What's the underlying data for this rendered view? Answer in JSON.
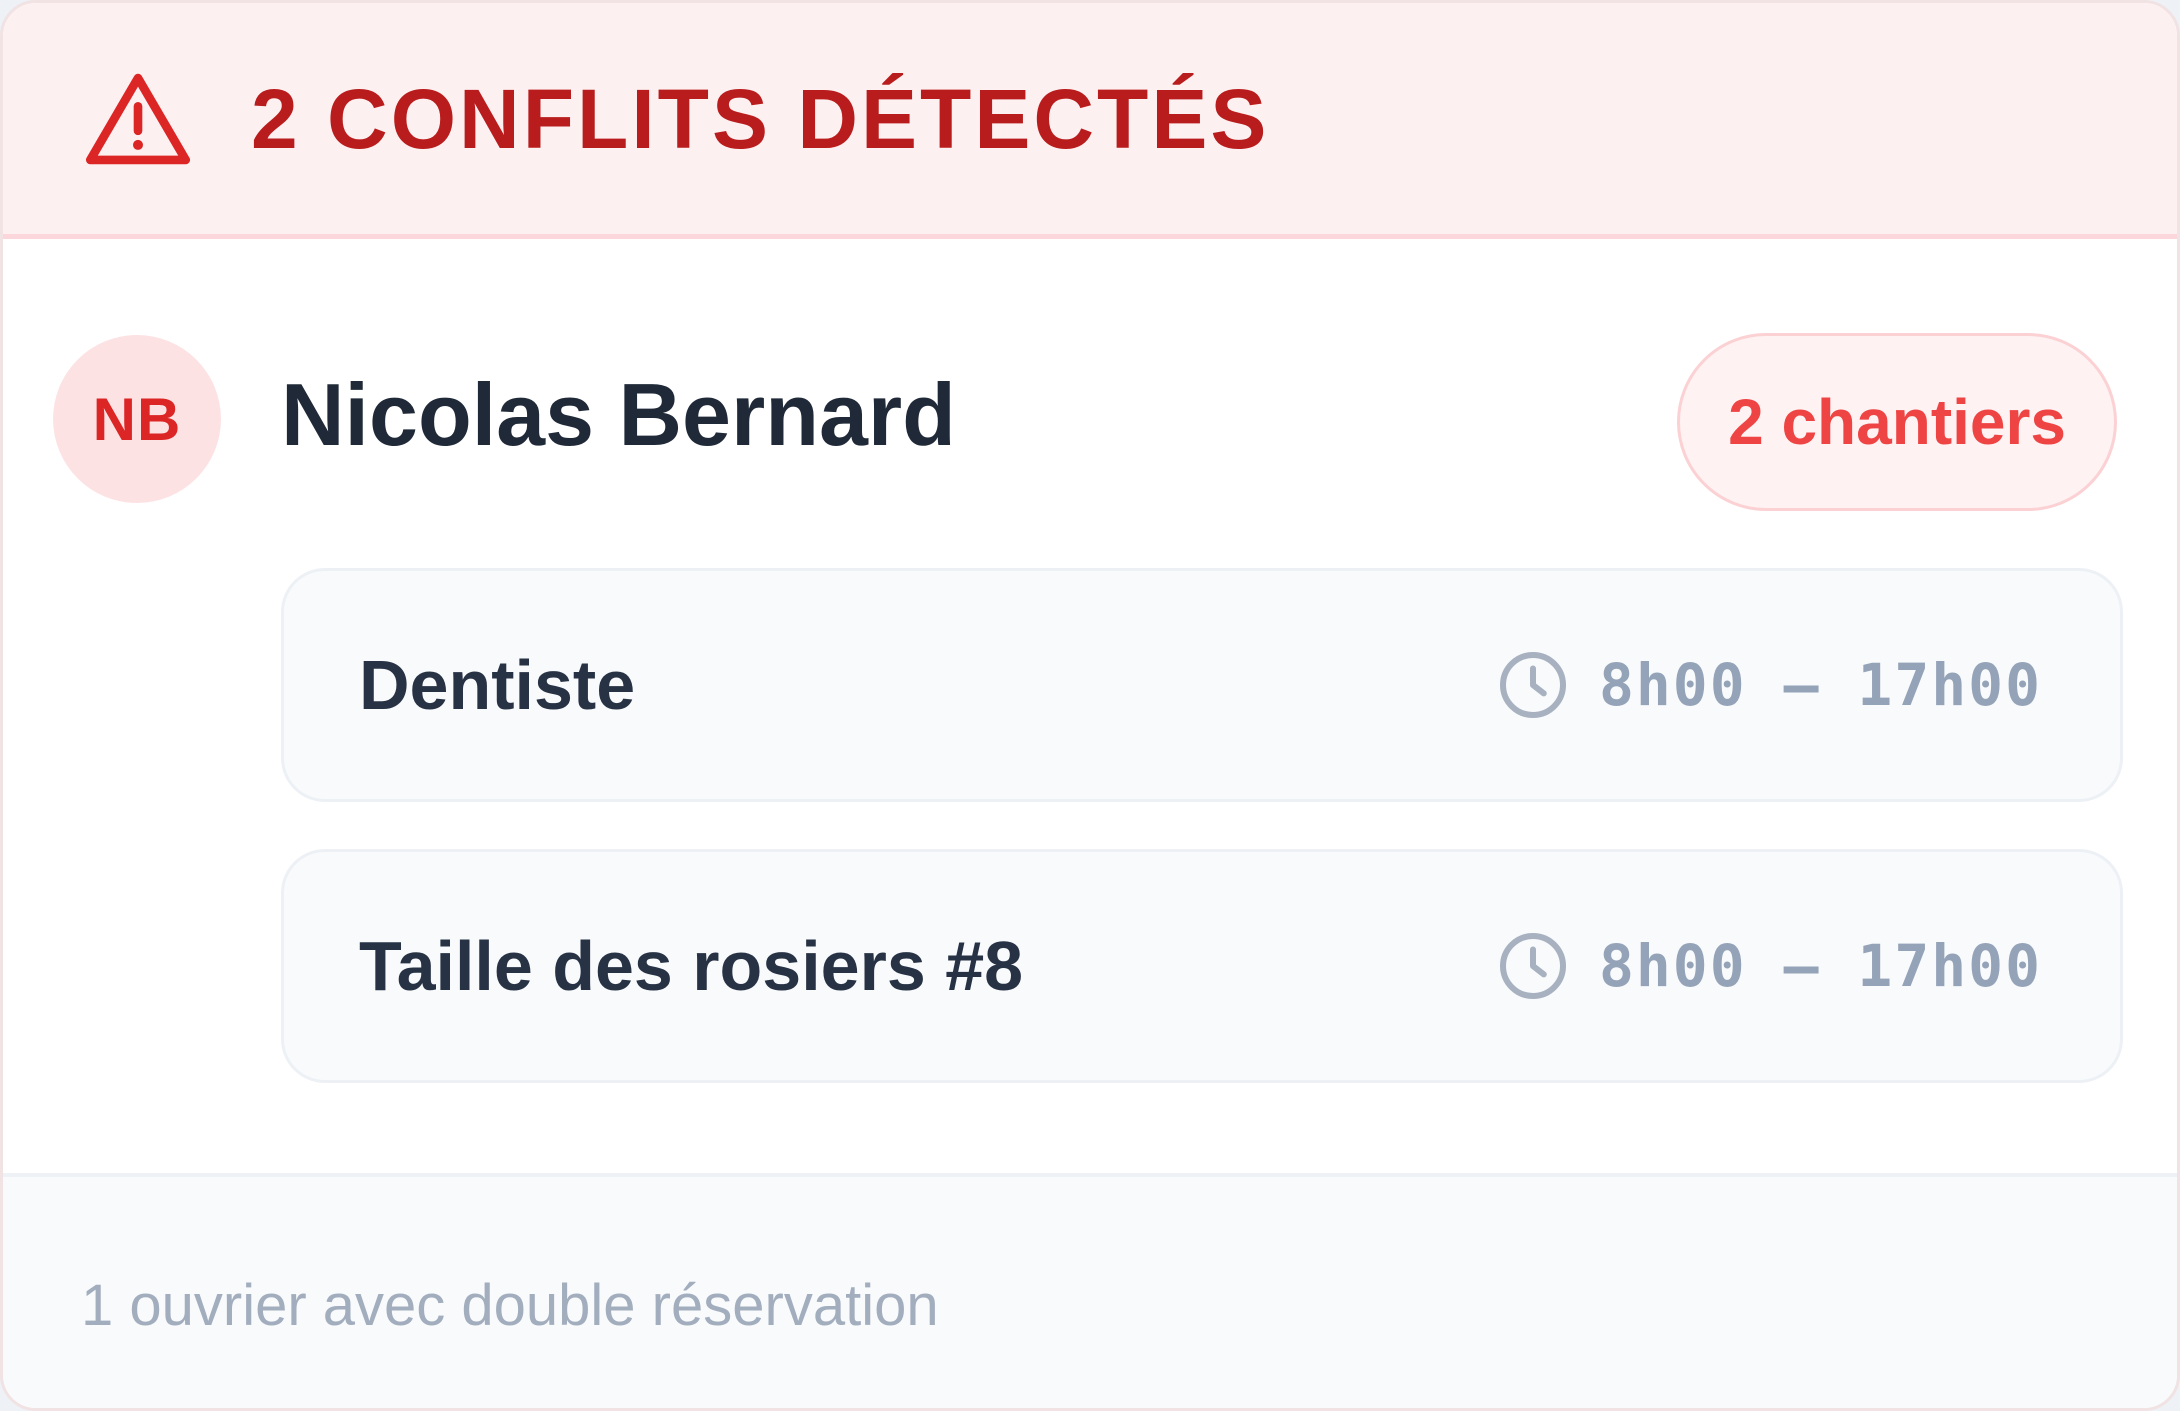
{
  "header": {
    "title": "2 CONFLITS DÉTECTÉS",
    "icon": "warning-triangle-icon",
    "accent_color": "#b91c1c",
    "background_color": "#fdf0f1"
  },
  "worker": {
    "initials": "NB",
    "name": "Nicolas Bernard",
    "badge": "2 chantiers",
    "badge_color": "#ef4444"
  },
  "sites": [
    {
      "name": "Dentiste",
      "time": "8h00 – 17h00",
      "icon": "clock-icon"
    },
    {
      "name": "Taille des rosiers #8",
      "time": "8h00 – 17h00",
      "icon": "clock-icon"
    }
  ],
  "footer": {
    "summary": "1 ouvrier avec double réservation"
  }
}
